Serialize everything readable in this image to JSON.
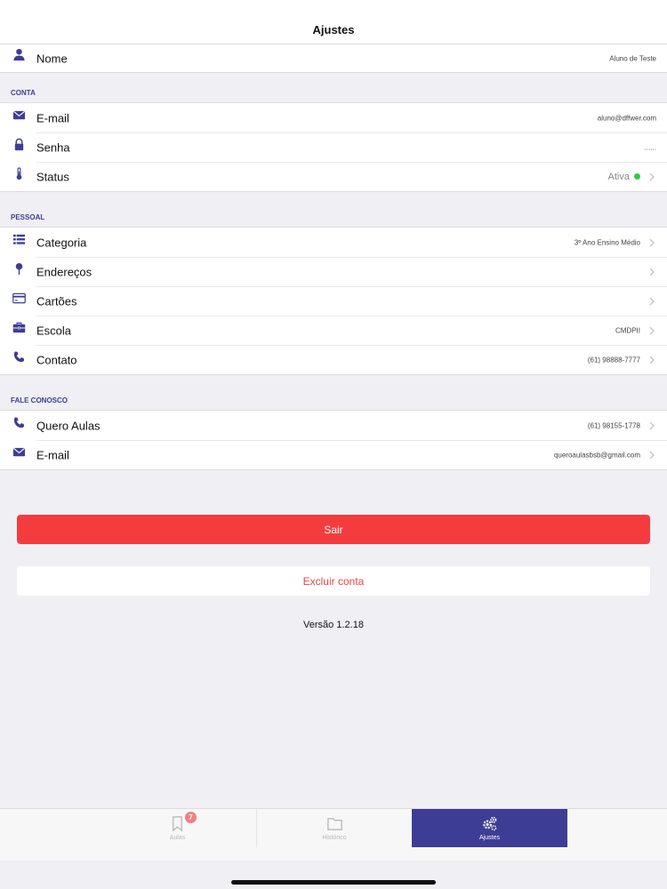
{
  "header": {
    "title": "Ajustes"
  },
  "profile": {
    "name_label": "Nome",
    "name_value": "Aluno de Teste"
  },
  "conta": {
    "title": "CONTA",
    "email_label": "E-mail",
    "email_value": "aluno@dffwer.com",
    "senha_label": "Senha",
    "senha_value": "......",
    "status_label": "Status",
    "status_value": "Ativa",
    "status_color": "#2ecc40"
  },
  "pessoal": {
    "title": "PESSOAL",
    "categoria_label": "Categoria",
    "categoria_value": "3º Ano Ensino Médio",
    "enderecos_label": "Endereços",
    "cartoes_label": "Cartões",
    "escola_label": "Escola",
    "escola_value": "CMDPII",
    "contato_label": "Contato",
    "contato_value": "(61) 98888-7777"
  },
  "fale_conosco": {
    "title": "FALE CONOSCO",
    "quero_label": "Quero Aulas",
    "quero_value": "(61) 98155-1778",
    "email_label": "E-mail",
    "email_value": "queroaulasbsb@gmail.com"
  },
  "actions": {
    "sair_label": "Sair",
    "excluir_label": "Excluir conta"
  },
  "version": "Versão 1.2.18",
  "tabs": {
    "aulas_label": "Aulas",
    "aulas_badge": "7",
    "historico_label": "Histórico",
    "ajustes_label": "Ajustes"
  },
  "colors": {
    "accent": "#3e3d95",
    "danger": "#f43c3e"
  },
  "icons": [
    "user-icon",
    "mail-icon",
    "lock-icon",
    "thermometer-icon",
    "list-icon",
    "pin-icon",
    "credit-card-icon",
    "briefcase-icon",
    "phone-icon",
    "bookmark-icon",
    "folder-icon",
    "gears-icon",
    "chevron-right-icon"
  ]
}
